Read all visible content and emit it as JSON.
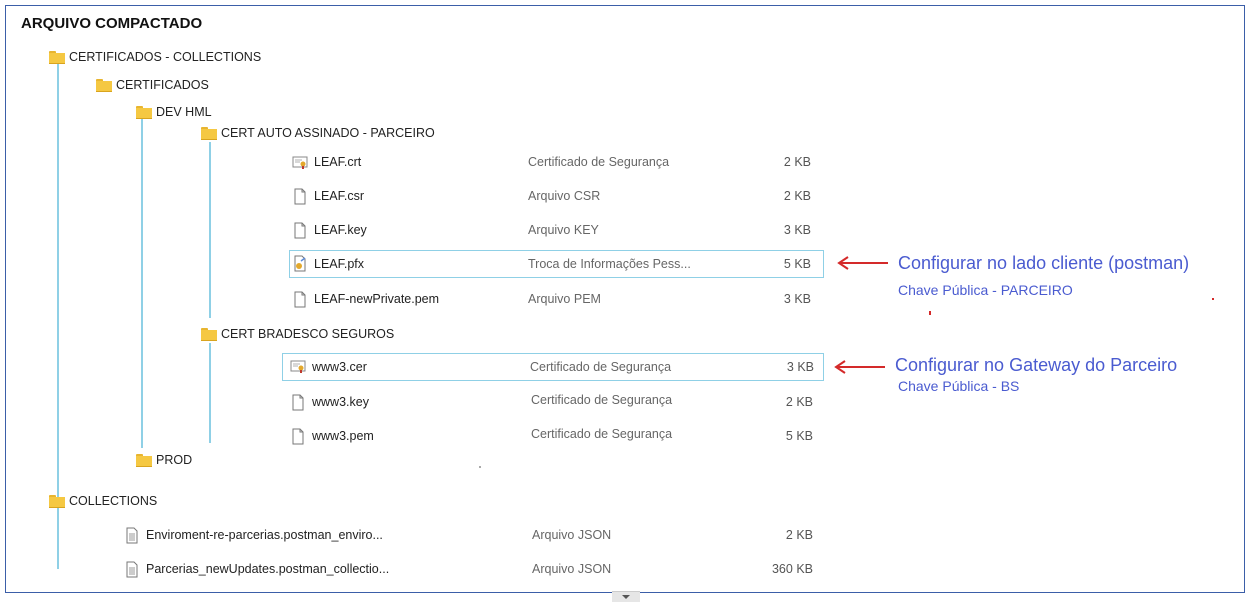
{
  "title": "ARQUIVO COMPACTADO",
  "folders": {
    "certificados_collections": "CERTIFICADOS - COLLECTIONS",
    "certificados": "CERTIFICADOS",
    "dev_hml": "DEV HML",
    "cert_auto": "CERT AUTO ASSINADO - PARCEIRO",
    "cert_bradesco": "CERT BRADESCO SEGUROS",
    "prod": "PROD",
    "collections": "COLLECTIONS"
  },
  "files_auto": [
    {
      "name": "LEAF.crt",
      "type": "Certificado de Segurança",
      "size": "2 KB",
      "icon": "certificate-icon"
    },
    {
      "name": "LEAF.csr",
      "type": "Arquivo CSR",
      "size": "2 KB",
      "icon": "file-icon"
    },
    {
      "name": "LEAF.key",
      "type": "Arquivo KEY",
      "size": "3 KB",
      "icon": "file-icon"
    },
    {
      "name": "LEAF.pfx",
      "type": "Troca de Informações Pess...",
      "size": "5 KB",
      "icon": "pfx-icon"
    },
    {
      "name": "LEAF-newPrivate.pem",
      "type": "Arquivo PEM",
      "size": "3 KB",
      "icon": "file-icon"
    }
  ],
  "files_bradesco": [
    {
      "name": "www3.cer",
      "type": "Certificado de Segurança",
      "size": "3 KB",
      "icon": "certificate-icon"
    },
    {
      "name": "www3.key",
      "type": "Certificado de Segurança",
      "size": "2 KB",
      "icon": "file-icon"
    },
    {
      "name": "www3.pem",
      "type": "Certificado de Segurança",
      "size": "5 KB",
      "icon": "file-icon"
    }
  ],
  "files_collections": [
    {
      "name": "Enviroment-re-parcerias.postman_enviro...",
      "type": "Arquivo JSON",
      "size": "2 KB",
      "icon": "document-icon"
    },
    {
      "name": "Parcerias_newUpdates.postman_collectio...",
      "type": "Arquivo JSON",
      "size": "360 KB",
      "icon": "document-icon"
    }
  ],
  "annotations": {
    "client_main": "Configurar no lado cliente  (postman)",
    "client_sub": "Chave Pública - PARCEIRO",
    "gateway_main": "Configurar no Gateway do Parceiro",
    "gateway_sub": "Chave Pública - BS"
  },
  "colors": {
    "annotation": "#4a5bd0",
    "arrow": "#d42a2a",
    "tree_line": "#8fd0e6",
    "folder": "#f5c842"
  }
}
